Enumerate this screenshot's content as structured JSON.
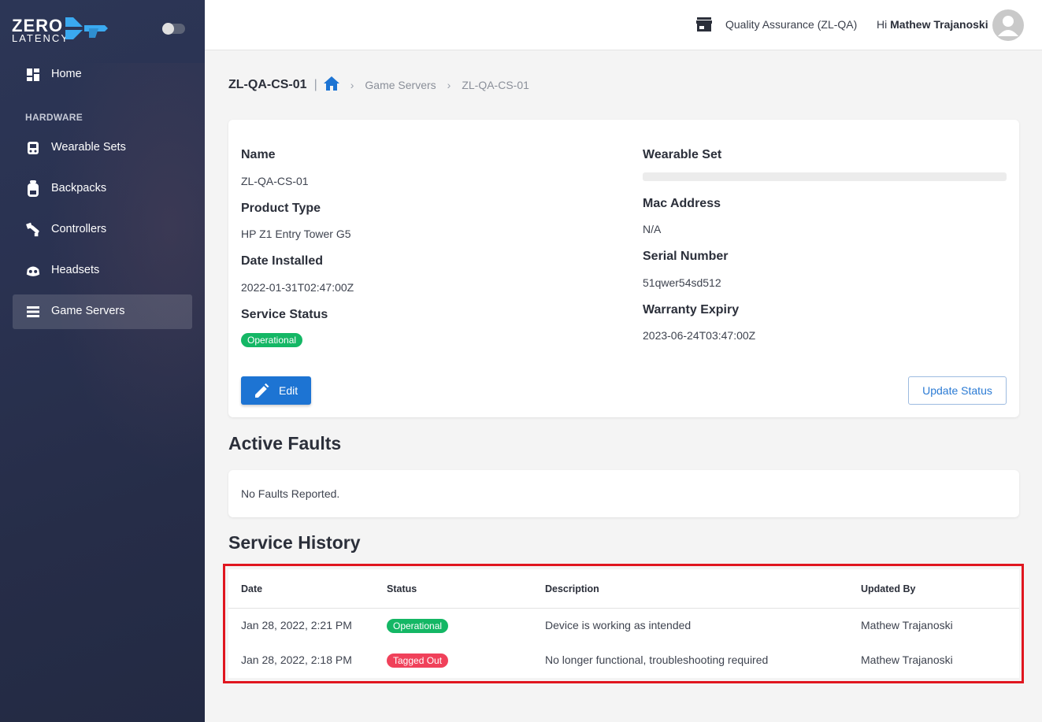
{
  "brand": {
    "line1": "ZERO",
    "line2": "LATENCY",
    "accent": "#3aa9f0"
  },
  "sidebar": {
    "section_hardware": "HARDWARE",
    "items": [
      {
        "label": "Home",
        "icon": "dashboard-icon"
      },
      {
        "label": "Wearable Sets",
        "icon": "wearable-icon"
      },
      {
        "label": "Backpacks",
        "icon": "backpack-icon"
      },
      {
        "label": "Controllers",
        "icon": "controller-icon"
      },
      {
        "label": "Headsets",
        "icon": "headset-icon"
      },
      {
        "label": "Game Servers",
        "icon": "server-icon",
        "active": true
      }
    ]
  },
  "topbar": {
    "org": "Quality Assurance (ZL-QA)",
    "greeting_prefix": "Hi",
    "user_name": "Mathew Trajanoski"
  },
  "breadcrumb": {
    "title": "ZL-QA-CS-01",
    "separator": "|",
    "links": [
      "Game Servers",
      "ZL-QA-CS-01"
    ]
  },
  "details": {
    "name_label": "Name",
    "name_value": "ZL-QA-CS-01",
    "product_type_label": "Product Type",
    "product_type_value": "HP Z1 Entry Tower G5",
    "date_installed_label": "Date Installed",
    "date_installed_value": "2022-01-31T02:47:00Z",
    "service_status_label": "Service Status",
    "service_status_value": "Operational",
    "wearable_set_label": "Wearable Set",
    "mac_address_label": "Mac Address",
    "mac_address_value": "N/A",
    "serial_number_label": "Serial Number",
    "serial_number_value": "51qwer54sd512",
    "warranty_expiry_label": "Warranty Expiry",
    "warranty_expiry_value": "2023-06-24T03:47:00Z",
    "edit_label": "Edit",
    "update_status_label": "Update Status"
  },
  "faults": {
    "title": "Active Faults",
    "message": "No Faults Reported."
  },
  "history": {
    "title": "Service History",
    "columns": [
      "Date",
      "Status",
      "Description",
      "Updated By"
    ],
    "rows": [
      {
        "date": "Jan 28, 2022, 2:21 PM",
        "status": "Operational",
        "description": "Device is working as intended",
        "updated_by": "Mathew Trajanoski"
      },
      {
        "date": "Jan 28, 2022, 2:18 PM",
        "status": "Tagged Out",
        "description": "No longer functional, troubleshooting required",
        "updated_by": "Mathew Trajanoski"
      }
    ]
  },
  "colors": {
    "primary": "#1d74d3",
    "operational": "#14b765",
    "tagged_out": "#f0415a",
    "highlight": "#e0161f"
  }
}
